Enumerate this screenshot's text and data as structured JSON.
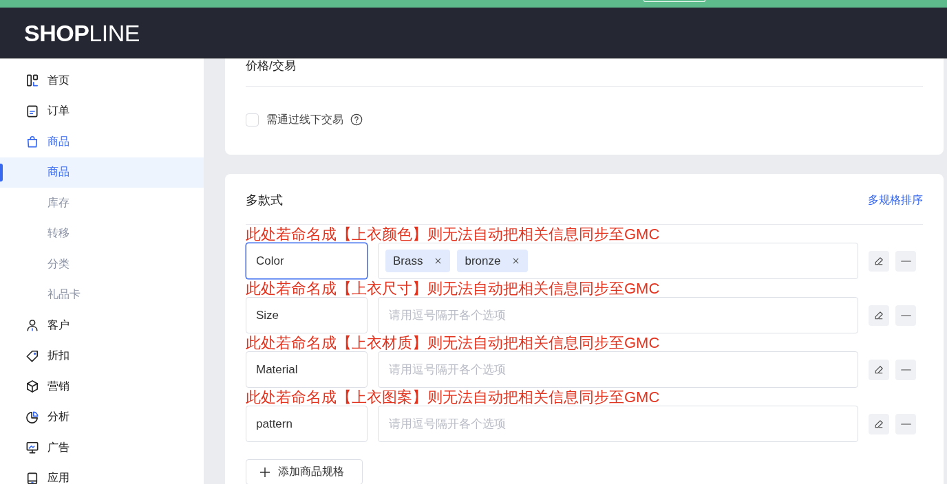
{
  "header": {
    "logo": "**SHOP**LINE"
  },
  "sidebar": {
    "items": [
      {
        "label": "首页",
        "selected": false
      },
      {
        "label": "订单",
        "selected": false
      },
      {
        "label": "商品",
        "selected": true,
        "children": [
          {
            "label": "商品",
            "selected": true
          },
          {
            "label": "库存",
            "selected": false
          },
          {
            "label": "转移",
            "selected": false
          },
          {
            "label": "分类",
            "selected": false
          },
          {
            "label": "礼品卡",
            "selected": false
          }
        ]
      },
      {
        "label": "客户",
        "selected": false
      },
      {
        "label": "折扣",
        "selected": false
      },
      {
        "label": "营销",
        "selected": false
      },
      {
        "label": "分析",
        "selected": false
      },
      {
        "label": "广告",
        "selected": false
      },
      {
        "label": "应用",
        "selected": false
      }
    ]
  },
  "pricing_card": {
    "title": "价格/交易",
    "offline_checkbox": {
      "label": "需通过线下交易",
      "checked": false
    }
  },
  "variants_card": {
    "title": "多款式",
    "sort_link": "多规格排序",
    "options": [
      {
        "note": "此处若命名成【上衣颜色】则无法自动把相关信息同步至GMC",
        "name": "Color",
        "focused": true,
        "values": [
          "Brass",
          "bronze"
        ]
      },
      {
        "note": "此处若命名成【上衣尺寸】则无法自动把相关信息同步至GMC",
        "name": "Size",
        "focused": false,
        "placeholder": "请用逗号隔开各个选项"
      },
      {
        "note": "此处若命名成【上衣材质】则无法自动把相关信息同步至GMC",
        "name": "Material",
        "focused": false,
        "placeholder": "请用逗号隔开各个选项"
      },
      {
        "note": "此处若命名成【上衣图案】则无法自动把相关信息同步至GMC",
        "name": "pattern",
        "focused": false,
        "placeholder": "请用逗号隔开各个选项"
      }
    ],
    "add_button": "添加商品规格"
  }
}
